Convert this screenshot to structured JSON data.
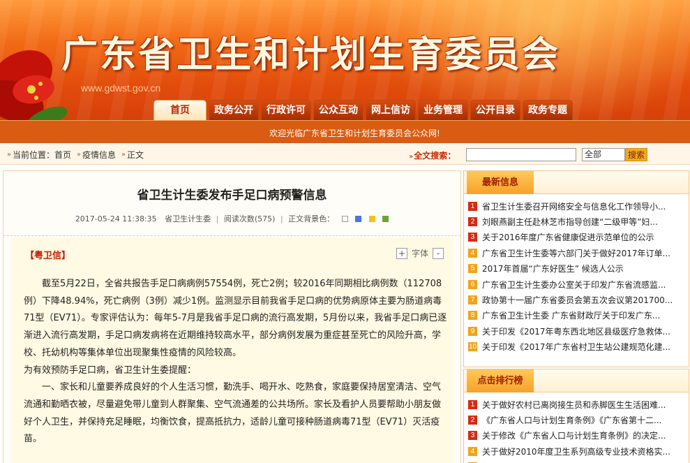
{
  "banner": {
    "title": "广东省卫生和计划生育委员会",
    "url": "www.gdwst.gov.cn"
  },
  "nav": {
    "tabs": [
      {
        "label": "首页",
        "active": true
      },
      {
        "label": "政务公开",
        "active": false
      },
      {
        "label": "行政许可",
        "active": false
      },
      {
        "label": "公众互动",
        "active": false
      },
      {
        "label": "网上信访",
        "active": false
      },
      {
        "label": "业务管理",
        "active": false
      },
      {
        "label": "公开目录",
        "active": false
      },
      {
        "label": "政务专题",
        "active": false
      }
    ]
  },
  "welcome": "欢迎光临广东省卫生和计划生育委员会公众网!",
  "breadcrumb": {
    "prefix": "当前位置：",
    "items": [
      "首页",
      "疫情信息",
      "正文"
    ]
  },
  "search": {
    "label": "全文搜索：",
    "value": "",
    "scope": "全部",
    "button": "搜索"
  },
  "article": {
    "title": "省卫生计生委发布手足口病预警信息",
    "date": "2017-05-24 11:38:35",
    "source": "省卫生计生委",
    "reads_label": "阅读次数",
    "reads_count": "575",
    "bg_label": "正文背景色：",
    "bg_colors": [
      "#ffffff",
      "#4a78d8",
      "#f2c21e",
      "#6aa33a"
    ],
    "tag": "【粤卫信】",
    "font_label": "字体",
    "font_plus": "+",
    "font_minus": "-",
    "paragraphs": [
      "截至5月22日，全省共报告手足口病病例57554例，死亡2例；较2016年同期相比病例数（112708例）下降48.94%，死亡病例（3例）减少1例。监测显示目前我省手足口病的优势病原体主要为肠道病毒71型（EV71）。专家评估认为：每年5-7月是我省手足口病的流行高发期，5月份以来，我省手足口病已逐渐进入流行高发期，手足口病发病将在近期维持较高水平，部分病例发展为重症甚至死亡的风险升高，学校、托幼机构等集体单位出现聚集性疫情的风险较高。",
      "为有效预防手足口病，省卫生计生委提醒：",
      "一、家长和儿童要养成良好的个人生活习惯，勤洗手、喝开水、吃熟食，家庭要保持居室清洁、空气流通和勤晒衣被，尽量避免带儿童到人群聚集、空气流通差的公共场所。家长及看护人员要帮助小朋友做好个人卫生，并保持充足睡眠，均衡饮食，提高抵抗力，适龄儿童可接种肠道病毒71型（EV71）灭活疫苗。"
    ]
  },
  "latest": {
    "title": "最新信息",
    "items": [
      "省卫生计生委召开网络安全与信息化工作领导小...",
      "刘眼燕副主任赴林芝市指导创建“二级甲等”妇...",
      "关于2016年度广东省健康促进示范单位的公示",
      "广东省卫生计生委等六部门关于做好2017年订单...",
      "2017年首届“广东好医生” 候选人公示",
      "广东省卫生计生委办公室关于印发广东省流感监...",
      "政协第十一届广东省委员会第五次会议第201700...",
      "广东省卫生计生委 广东省财政厅关于印发广东...",
      "关于印发《2017年粤东西北地区县级医疗急救体...",
      "关于印发《2017年广东省村卫生站公建规范化建..."
    ]
  },
  "ranking": {
    "title": "点击排行榜",
    "items": [
      "关于做好农村已离岗接生员和赤脚医生生活困难...",
      "《广东省人口与计划生育条例》《广东省第十二...",
      "关于修改《广东省人口与计划生育条例》的决定...",
      "关于做好2010年度卫生系列高级专业技术资格实...",
      "领导介绍"
    ]
  }
}
